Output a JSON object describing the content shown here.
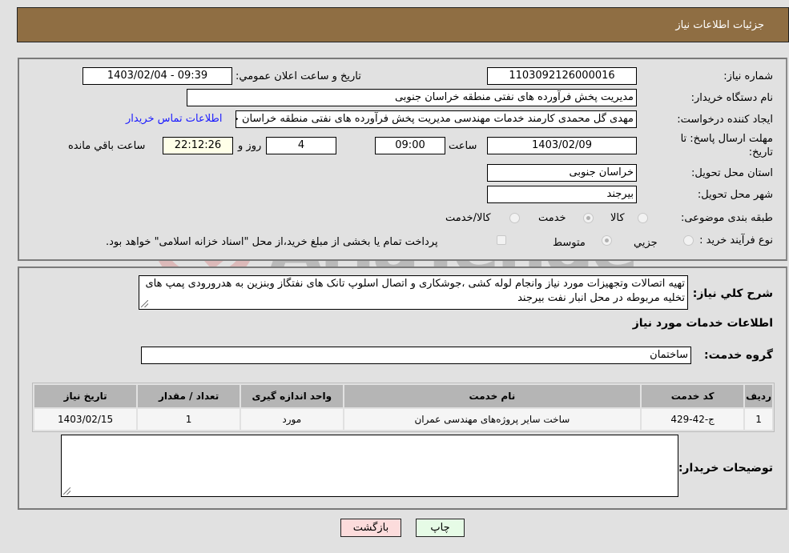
{
  "header": {
    "title": "جزئیات اطلاعات نیاز"
  },
  "info": {
    "need_number_label": "شماره نیاز:",
    "need_number": "1103092126000016",
    "announce_label": "تاريخ و ساعت اعلان عمومي:",
    "announce_value": "1403/02/04 - 09:39",
    "buyer_org_label": "نام دستگاه خریدار:",
    "buyer_org": "مدیریت پخش فرآورده های نفتی منطقه خراسان جنوبی",
    "creator_label": "ایجاد کننده درخواست:",
    "creator": "مهدی گل محمدی کارمند خدمات مهندسی مدیریت پخش فرآورده های نفتی منطقه خراسان جنوبی",
    "contact_link": "اطلاعات تماس خریدار",
    "deadline_label": "مهلت ارسال پاسخ: تا تاریخ:",
    "deadline_date": "1403/02/09",
    "time_label": "ساعت",
    "deadline_time": "09:00",
    "days_value": "4",
    "days_label": "روز و",
    "remaining_time": "22:12:26",
    "remaining_label": "ساعت باقي مانده",
    "province_label": "استان محل تحویل:",
    "province": "خراسان جنوبی",
    "city_label": "شهر محل تحویل:",
    "city": "بیرجند",
    "category_label": "طبقه بندی موضوعی:",
    "category_options": [
      {
        "label": "کالا",
        "checked": false
      },
      {
        "label": "خدمت",
        "checked": true
      },
      {
        "label": "کالا/خدمت",
        "checked": false
      }
    ],
    "process_label": "نوع فرآیند خرید :",
    "process_options": [
      {
        "label": "جزيي",
        "checked": false
      },
      {
        "label": "متوسط",
        "checked": true
      }
    ],
    "treasury_note": "پرداخت تمام یا بخشی از مبلغ خرید،از محل \"اسناد خزانه اسلامی\" خواهد بود.",
    "treasury_checked": false
  },
  "details": {
    "description_label": "شرح کلي نياز:",
    "description": "تهیه اتصالات وتجهیزات مورد نیاز وانجام لوله کشی ،جوشکاری و اتصال اسلوپ تانک های نفتگاز وبنزین به هدرورودی پمپ های تخلیه مربوطه در محل انبار نفت بیرجند",
    "services_title": "اطلاعات خدمات مورد نياز",
    "service_group_label": "گروه خدمت:",
    "service_group": "ساختمان",
    "table": {
      "headers": [
        "رديف",
        "کد خدمت",
        "نام خدمت",
        "واحد اندازه گیری",
        "تعداد / مقدار",
        "تاریخ نیاز"
      ],
      "rows": [
        [
          "1",
          "ج-42-429",
          "ساخت سایر پروژه‌های مهندسی عمران",
          "مورد",
          "1",
          "1403/02/15"
        ]
      ]
    },
    "buyer_notes_label": "توضیحات خریدار:",
    "buyer_notes": ""
  },
  "buttons": {
    "print": "چاپ",
    "back": "بازگشت"
  },
  "watermark": {
    "text": "AriaTender.neT"
  }
}
